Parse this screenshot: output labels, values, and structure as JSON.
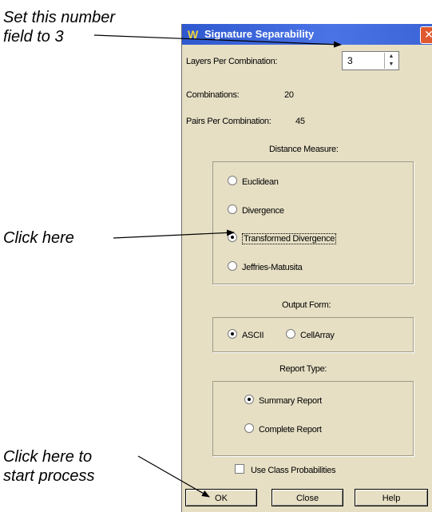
{
  "annotations": {
    "set_field": "Set this number\nfield to 3",
    "click_here": "Click here",
    "click_start": "Click here to\nstart process"
  },
  "window": {
    "title": "Signature Separability",
    "close_symbol": "✕",
    "app_icon_glyph": "W"
  },
  "layers_per_combination": {
    "label": "Layers Per Combination:",
    "value": "3"
  },
  "combinations": {
    "label": "Combinations:",
    "value": "20"
  },
  "pairs_per_combination": {
    "label": "Pairs Per Combination:",
    "value": "45"
  },
  "distance_measure": {
    "label": "Distance Measure:",
    "options": [
      "Euclidean",
      "Divergence",
      "Transformed Divergence",
      "Jeffries-Matusita"
    ],
    "selected": "Transformed Divergence"
  },
  "output_form": {
    "label": "Output Form:",
    "options": [
      "ASCII",
      "CellArray"
    ],
    "selected": "ASCII"
  },
  "report_type": {
    "label": "Report Type:",
    "options": [
      "Summary Report",
      "Complete Report"
    ],
    "selected": "Summary Report"
  },
  "use_class_probabilities": {
    "label": "Use Class Probabilities",
    "checked": false
  },
  "buttons": {
    "ok": "OK",
    "close": "Close",
    "help": "Help"
  },
  "colors": {
    "dialog_bg": "#e6dfc4",
    "titlebar": "#3c64d6",
    "close_button": "#e0592e"
  }
}
